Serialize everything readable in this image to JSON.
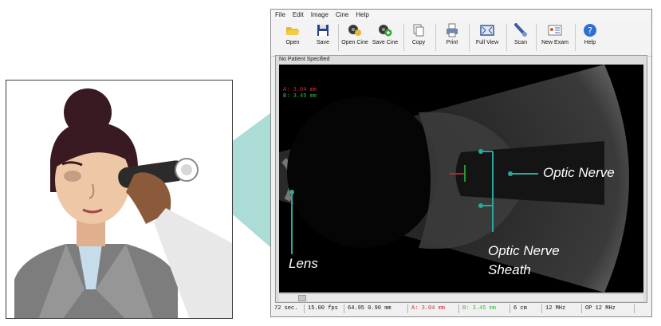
{
  "window": {
    "menu": [
      "File",
      "Edit",
      "Image",
      "Cine",
      "Help"
    ],
    "toolbar": [
      {
        "label": "Open",
        "icon": "open-folder-icon"
      },
      {
        "label": "Save",
        "icon": "save-disk-icon"
      },
      {
        "label": "Open Cine",
        "icon": "open-cine-icon"
      },
      {
        "label": "Save Cine",
        "icon": "save-cine-icon"
      },
      {
        "label": "Copy",
        "icon": "copy-icon"
      },
      {
        "label": "Print",
        "icon": "printer-icon"
      },
      {
        "label": "Full View",
        "icon": "full-view-icon"
      },
      {
        "label": "Scan",
        "icon": "probe-icon"
      },
      {
        "label": "New Exam",
        "icon": "new-exam-icon"
      },
      {
        "label": "Help",
        "icon": "help-icon"
      }
    ],
    "panel_title": "No Patient Specified",
    "measurements": {
      "a": "A: 3.04 mm",
      "b": "B: 3.45 mm"
    },
    "status": [
      "72 sec.",
      "15.00 fps",
      "64.95  0.90 mm",
      "A: 3.04 mm",
      "B: 3.45 mm",
      "6 cm",
      "12 MHz",
      "OP 12 MHz"
    ]
  },
  "annotations": {
    "optic_nerve": "Optic Nerve",
    "lens": "Lens",
    "sheath_line1": "Optic Nerve",
    "sheath_line2": "Sheath"
  },
  "colors": {
    "beam": "#6fbfb4",
    "annotation_line": "#2aa89a",
    "measure_a": "#d03030",
    "measure_b": "#2fbf3a"
  }
}
